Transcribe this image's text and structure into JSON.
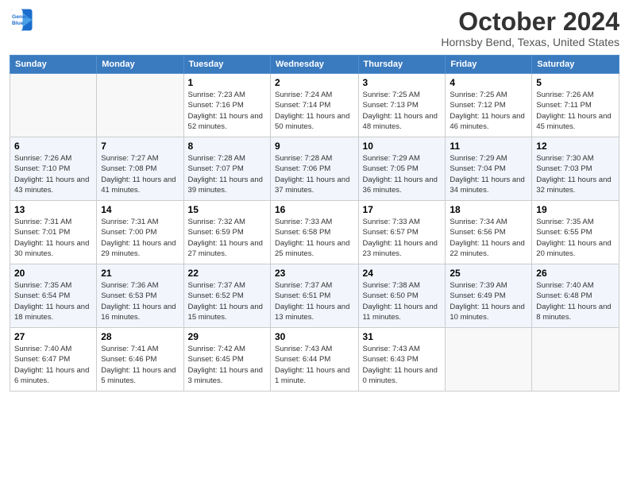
{
  "header": {
    "logo_line1": "General",
    "logo_line2": "Blue",
    "month_title": "October 2024",
    "location": "Hornsby Bend, Texas, United States"
  },
  "days_of_week": [
    "Sunday",
    "Monday",
    "Tuesday",
    "Wednesday",
    "Thursday",
    "Friday",
    "Saturday"
  ],
  "weeks": [
    [
      {
        "day": "",
        "sunrise": "",
        "sunset": "",
        "daylight": ""
      },
      {
        "day": "",
        "sunrise": "",
        "sunset": "",
        "daylight": ""
      },
      {
        "day": "1",
        "sunrise": "Sunrise: 7:23 AM",
        "sunset": "Sunset: 7:16 PM",
        "daylight": "Daylight: 11 hours and 52 minutes."
      },
      {
        "day": "2",
        "sunrise": "Sunrise: 7:24 AM",
        "sunset": "Sunset: 7:14 PM",
        "daylight": "Daylight: 11 hours and 50 minutes."
      },
      {
        "day": "3",
        "sunrise": "Sunrise: 7:25 AM",
        "sunset": "Sunset: 7:13 PM",
        "daylight": "Daylight: 11 hours and 48 minutes."
      },
      {
        "day": "4",
        "sunrise": "Sunrise: 7:25 AM",
        "sunset": "Sunset: 7:12 PM",
        "daylight": "Daylight: 11 hours and 46 minutes."
      },
      {
        "day": "5",
        "sunrise": "Sunrise: 7:26 AM",
        "sunset": "Sunset: 7:11 PM",
        "daylight": "Daylight: 11 hours and 45 minutes."
      }
    ],
    [
      {
        "day": "6",
        "sunrise": "Sunrise: 7:26 AM",
        "sunset": "Sunset: 7:10 PM",
        "daylight": "Daylight: 11 hours and 43 minutes."
      },
      {
        "day": "7",
        "sunrise": "Sunrise: 7:27 AM",
        "sunset": "Sunset: 7:08 PM",
        "daylight": "Daylight: 11 hours and 41 minutes."
      },
      {
        "day": "8",
        "sunrise": "Sunrise: 7:28 AM",
        "sunset": "Sunset: 7:07 PM",
        "daylight": "Daylight: 11 hours and 39 minutes."
      },
      {
        "day": "9",
        "sunrise": "Sunrise: 7:28 AM",
        "sunset": "Sunset: 7:06 PM",
        "daylight": "Daylight: 11 hours and 37 minutes."
      },
      {
        "day": "10",
        "sunrise": "Sunrise: 7:29 AM",
        "sunset": "Sunset: 7:05 PM",
        "daylight": "Daylight: 11 hours and 36 minutes."
      },
      {
        "day": "11",
        "sunrise": "Sunrise: 7:29 AM",
        "sunset": "Sunset: 7:04 PM",
        "daylight": "Daylight: 11 hours and 34 minutes."
      },
      {
        "day": "12",
        "sunrise": "Sunrise: 7:30 AM",
        "sunset": "Sunset: 7:03 PM",
        "daylight": "Daylight: 11 hours and 32 minutes."
      }
    ],
    [
      {
        "day": "13",
        "sunrise": "Sunrise: 7:31 AM",
        "sunset": "Sunset: 7:01 PM",
        "daylight": "Daylight: 11 hours and 30 minutes."
      },
      {
        "day": "14",
        "sunrise": "Sunrise: 7:31 AM",
        "sunset": "Sunset: 7:00 PM",
        "daylight": "Daylight: 11 hours and 29 minutes."
      },
      {
        "day": "15",
        "sunrise": "Sunrise: 7:32 AM",
        "sunset": "Sunset: 6:59 PM",
        "daylight": "Daylight: 11 hours and 27 minutes."
      },
      {
        "day": "16",
        "sunrise": "Sunrise: 7:33 AM",
        "sunset": "Sunset: 6:58 PM",
        "daylight": "Daylight: 11 hours and 25 minutes."
      },
      {
        "day": "17",
        "sunrise": "Sunrise: 7:33 AM",
        "sunset": "Sunset: 6:57 PM",
        "daylight": "Daylight: 11 hours and 23 minutes."
      },
      {
        "day": "18",
        "sunrise": "Sunrise: 7:34 AM",
        "sunset": "Sunset: 6:56 PM",
        "daylight": "Daylight: 11 hours and 22 minutes."
      },
      {
        "day": "19",
        "sunrise": "Sunrise: 7:35 AM",
        "sunset": "Sunset: 6:55 PM",
        "daylight": "Daylight: 11 hours and 20 minutes."
      }
    ],
    [
      {
        "day": "20",
        "sunrise": "Sunrise: 7:35 AM",
        "sunset": "Sunset: 6:54 PM",
        "daylight": "Daylight: 11 hours and 18 minutes."
      },
      {
        "day": "21",
        "sunrise": "Sunrise: 7:36 AM",
        "sunset": "Sunset: 6:53 PM",
        "daylight": "Daylight: 11 hours and 16 minutes."
      },
      {
        "day": "22",
        "sunrise": "Sunrise: 7:37 AM",
        "sunset": "Sunset: 6:52 PM",
        "daylight": "Daylight: 11 hours and 15 minutes."
      },
      {
        "day": "23",
        "sunrise": "Sunrise: 7:37 AM",
        "sunset": "Sunset: 6:51 PM",
        "daylight": "Daylight: 11 hours and 13 minutes."
      },
      {
        "day": "24",
        "sunrise": "Sunrise: 7:38 AM",
        "sunset": "Sunset: 6:50 PM",
        "daylight": "Daylight: 11 hours and 11 minutes."
      },
      {
        "day": "25",
        "sunrise": "Sunrise: 7:39 AM",
        "sunset": "Sunset: 6:49 PM",
        "daylight": "Daylight: 11 hours and 10 minutes."
      },
      {
        "day": "26",
        "sunrise": "Sunrise: 7:40 AM",
        "sunset": "Sunset: 6:48 PM",
        "daylight": "Daylight: 11 hours and 8 minutes."
      }
    ],
    [
      {
        "day": "27",
        "sunrise": "Sunrise: 7:40 AM",
        "sunset": "Sunset: 6:47 PM",
        "daylight": "Daylight: 11 hours and 6 minutes."
      },
      {
        "day": "28",
        "sunrise": "Sunrise: 7:41 AM",
        "sunset": "Sunset: 6:46 PM",
        "daylight": "Daylight: 11 hours and 5 minutes."
      },
      {
        "day": "29",
        "sunrise": "Sunrise: 7:42 AM",
        "sunset": "Sunset: 6:45 PM",
        "daylight": "Daylight: 11 hours and 3 minutes."
      },
      {
        "day": "30",
        "sunrise": "Sunrise: 7:43 AM",
        "sunset": "Sunset: 6:44 PM",
        "daylight": "Daylight: 11 hours and 1 minute."
      },
      {
        "day": "31",
        "sunrise": "Sunrise: 7:43 AM",
        "sunset": "Sunset: 6:43 PM",
        "daylight": "Daylight: 11 hours and 0 minutes."
      },
      {
        "day": "",
        "sunrise": "",
        "sunset": "",
        "daylight": ""
      },
      {
        "day": "",
        "sunrise": "",
        "sunset": "",
        "daylight": ""
      }
    ]
  ]
}
